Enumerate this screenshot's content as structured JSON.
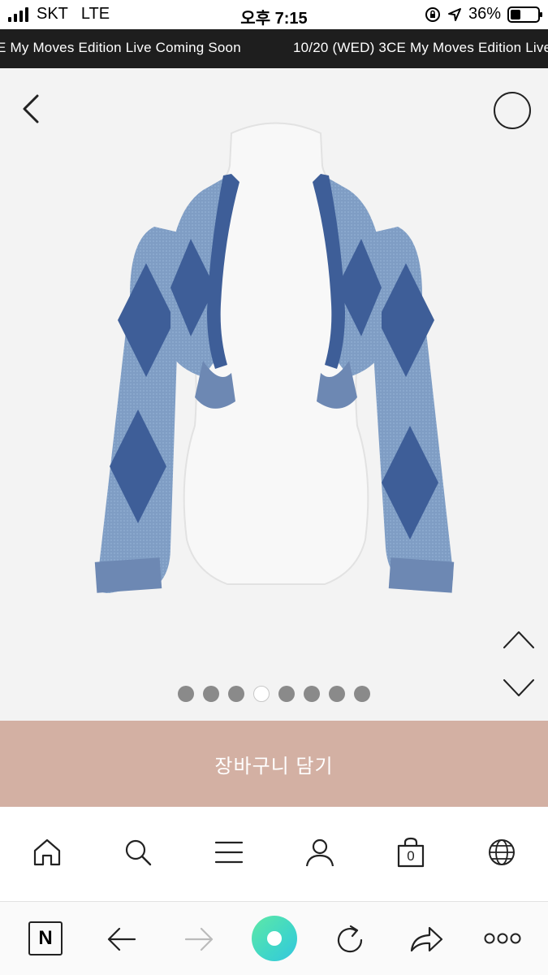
{
  "status_bar": {
    "carrier": "SKT",
    "network": "LTE",
    "time": "오후 7:15",
    "battery": "36%",
    "battery_level": 0.36
  },
  "marquee": {
    "text_left": "E My Moves Edition Live Coming Soon",
    "text_right": "10/20 (WED) 3CE My Moves Edition Live"
  },
  "product": {
    "image_icon": "blue-argyle-cardigan-image",
    "slides_total": 8,
    "active_slide": 4
  },
  "cart_button": {
    "label": "장바구니 담기"
  },
  "site_nav": {
    "cart_count": "0",
    "items": [
      "home-icon",
      "search-icon",
      "menu-icon",
      "user-icon",
      "cart-icon",
      "globe-icon"
    ]
  },
  "browser_toolbar": {
    "n_label": "N",
    "items": [
      "naver-n-icon",
      "back-arrow-icon",
      "forward-arrow-icon",
      "green-circle-icon",
      "reload-icon",
      "share-icon",
      "more-icon"
    ]
  },
  "colors": {
    "accent": "#d3b0a3",
    "marquee_bg": "#1e1e1e",
    "product_bg": "#f3f3f3"
  }
}
